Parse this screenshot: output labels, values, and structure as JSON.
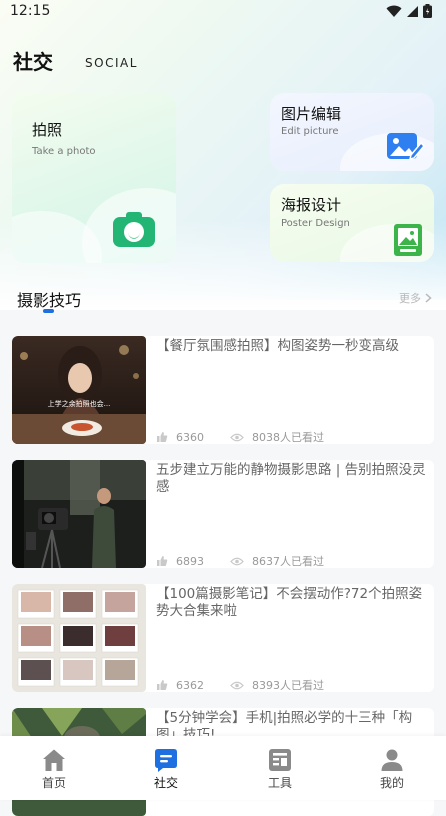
{
  "status": {
    "time": "12:15"
  },
  "header": {
    "title": "社交",
    "subtitle": "SOCIAL"
  },
  "tools": {
    "photo": {
      "title": "拍照",
      "subtitle": "Take a photo"
    },
    "edit": {
      "title": "图片编辑",
      "subtitle": "Edit picture"
    },
    "poster": {
      "title": "海报设计",
      "subtitle": "Poster Design"
    }
  },
  "section": {
    "title": "摄影技巧",
    "more": "更多"
  },
  "articles": [
    {
      "title": "【餐厅氛围感拍照】构图姿势一秒变高级",
      "likes": "6360",
      "views": "8038人已看过"
    },
    {
      "title": "五步建立万能的静物摄影思路 | 告别拍照没灵感",
      "likes": "6893",
      "views": "8637人已看过"
    },
    {
      "title": "【100篇摄影笔记】不会摆动作?72个拍照姿势大合集来啦",
      "likes": "6362",
      "views": "8393人已看过"
    },
    {
      "title": "【5分钟学会】手机|拍照必学的十三种「构图」技巧!"
    }
  ],
  "nav": {
    "items": [
      {
        "label": "首页",
        "icon": "home-icon"
      },
      {
        "label": "社交",
        "icon": "social-icon",
        "active": true
      },
      {
        "label": "工具",
        "icon": "tools-icon"
      },
      {
        "label": "我的",
        "icon": "profile-icon"
      }
    ]
  },
  "colors": {
    "accent": "#1e6fe0",
    "green": "#22b573",
    "inactive_icon": "#8a8a8a"
  }
}
